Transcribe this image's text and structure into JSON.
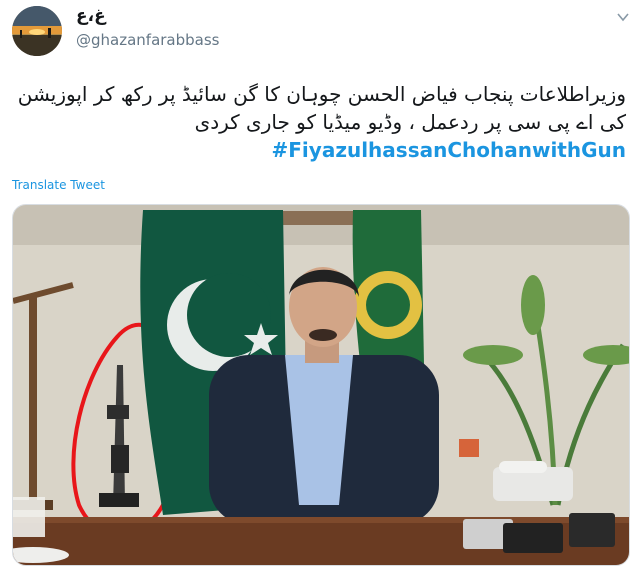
{
  "author": {
    "display_name": "غ،ع",
    "handle": "@ghazanfarabbass"
  },
  "tweet": {
    "text_line1": "وزیراطلاعات پنجاب فیاض الحسن چوہان کا گن سائیڈ پر رکھ کر اپوزیشن",
    "text_line2": "کی اے پی سی پر ردعمل ، وڈیو میڈیا کو جاری کردی",
    "hashtag": "#FiyazulhassanChohanwithGun"
  },
  "actions": {
    "translate_label": "Translate Tweet"
  },
  "media": {
    "description_icon": "video-thumbnail"
  },
  "colors": {
    "link": "#1b95e0",
    "annotation_circle": "#e8161a",
    "flag_green": "#115740"
  }
}
